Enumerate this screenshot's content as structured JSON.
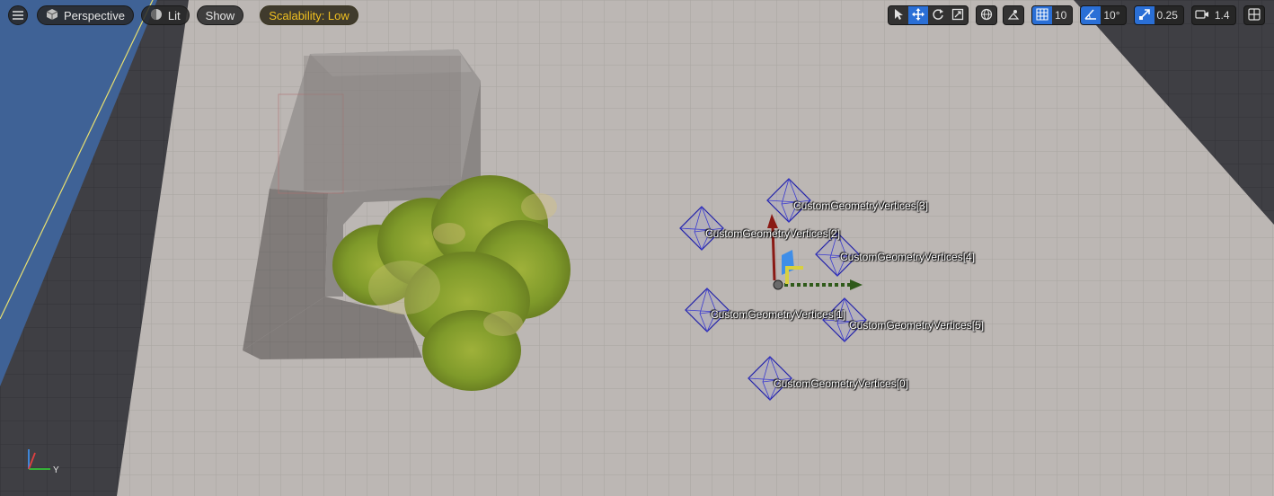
{
  "toolbar": {
    "menu_icon": "hamburger-icon",
    "view_mode": "Perspective",
    "lighting": "Lit",
    "show": "Show",
    "scalability": "Scalability: Low",
    "grid_snap_value": "10",
    "rotation_snap_value": "10°",
    "scale_snap_value": "0.25",
    "camera_speed_value": "1.4",
    "accent": "#2a6fd6",
    "scalability_color": "#f0c020"
  },
  "viewport": {
    "vertex_labels": [
      "CustomGeometryVertices[0]",
      "CustomGeometryVertices[1]",
      "CustomGeometryVertices[2]",
      "CustomGeometryVertices[3]",
      "CustomGeometryVertices[4]",
      "CustomGeometryVertices[5]"
    ],
    "axis_x_label": "",
    "axis_y_label": "Y"
  }
}
